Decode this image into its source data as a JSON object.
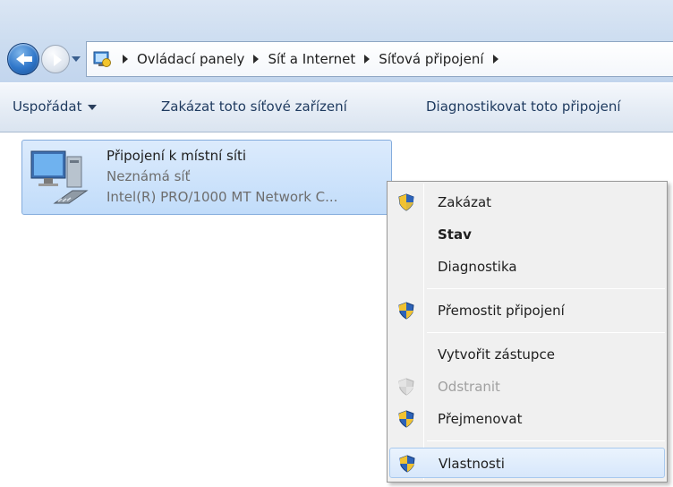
{
  "address_bar": {
    "breadcrumbs": [
      "Ovládací panely",
      "Síť a Internet",
      "Síťová připojení"
    ]
  },
  "command_bar": {
    "organize_label": "Uspořádat",
    "disable_label": "Zakázat toto síťové zařízení",
    "diagnose_label": "Diagnostikovat toto připojení"
  },
  "connection": {
    "name": "Připojení k místní síti",
    "network": "Neznámá síť",
    "adapter": "Intel(R) PRO/1000 MT Network C..."
  },
  "context_menu": {
    "items": [
      {
        "label": "Zakázat",
        "icon": "shield-icon"
      },
      {
        "label": "Stav",
        "icon": ""
      },
      {
        "label": "Diagnostika",
        "icon": ""
      },
      {
        "label": "Přemostit připojení",
        "icon": "shield-icon"
      },
      {
        "label": "Vytvořit zástupce",
        "icon": ""
      },
      {
        "label": "Odstranit",
        "icon": "shield-icon"
      },
      {
        "label": "Přejmenovat",
        "icon": "shield-icon"
      },
      {
        "label": "Vlastnosti",
        "icon": "shield-icon"
      }
    ]
  },
  "colors": {
    "selection": "#c1dcfa",
    "menu_background": "#f0f0f0",
    "titlebar": "#cbdcf0"
  }
}
